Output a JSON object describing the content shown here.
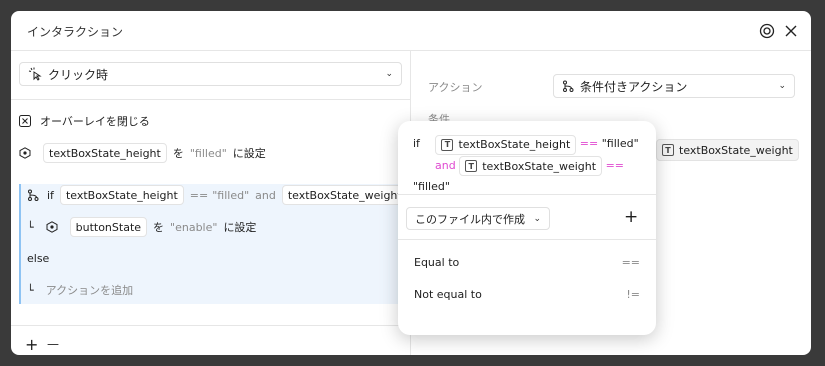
{
  "dialog": {
    "title": "インタラクション"
  },
  "left": {
    "trigger": "クリック時",
    "actions": [
      {
        "label": "オーバーレイを閉じる"
      },
      {
        "chip": "textBoxState_height",
        "to": "を",
        "value": "\"filled\"",
        "suffix": "に設定"
      }
    ],
    "if_row": {
      "kw": "if",
      "chip1": "textBoxState_height",
      "op1": "==",
      "val1": "\"filled\"",
      "and": "and",
      "chip2": "textBoxState_weight",
      "op2": "=="
    },
    "inner": {
      "chip": "buttonState",
      "to": "を",
      "value": "\"enable\"",
      "suffix": "に設定"
    },
    "else": "else",
    "add_action": "アクションを追加",
    "plus": "+",
    "minus": "—"
  },
  "right": {
    "action_label": "アクション",
    "action_value": "条件付きアクション",
    "condition_label": "条件",
    "peek_chip": "textBoxState_weight"
  },
  "popover": {
    "if": "if",
    "chip1": "textBoxState_height",
    "op1": "==",
    "val1": "\"filled\"",
    "and": "and",
    "chip2": "textBoxState_weight",
    "op2": "==",
    "val2": "\"filled\"",
    "source": "このファイル内で作成",
    "add": "+",
    "options": [
      {
        "label": "Equal to",
        "op": "=="
      },
      {
        "label": "Not equal to",
        "op": "!="
      }
    ]
  },
  "colors": {
    "accent": "#8ec3f3",
    "selected_bg": "#eef5fd",
    "keyword": "#e04ad1"
  }
}
